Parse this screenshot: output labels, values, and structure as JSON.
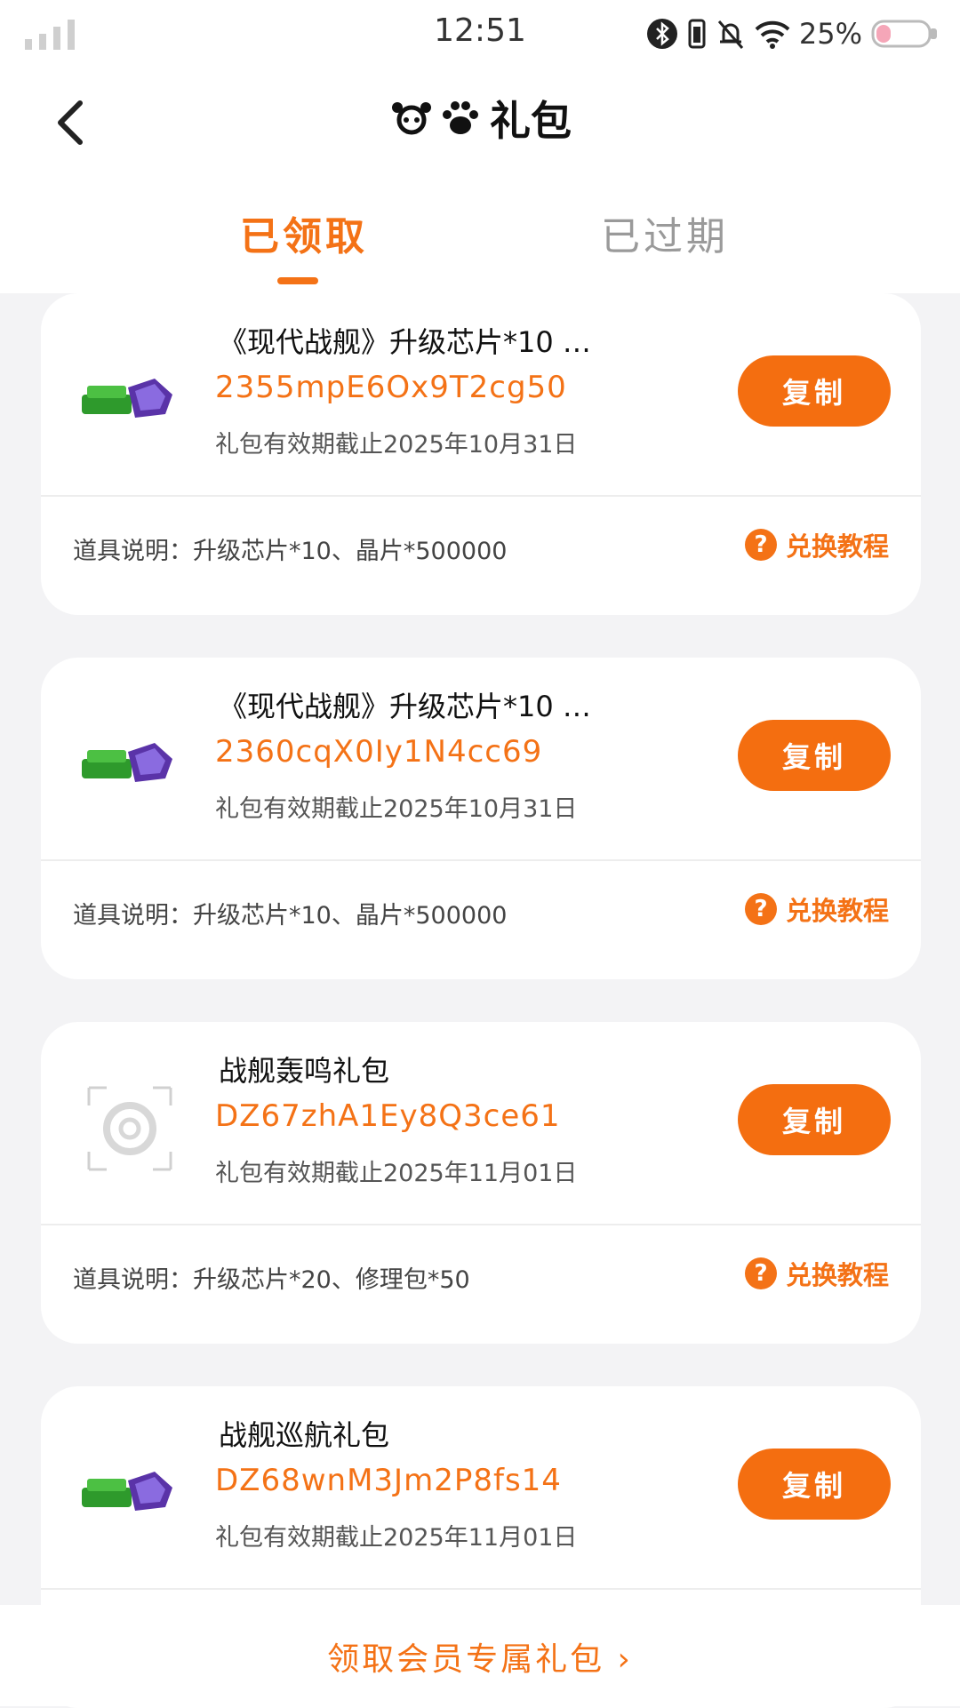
{
  "status_bar": {
    "time": "12:51",
    "battery_percent": "25%"
  },
  "header": {
    "title": "礼包"
  },
  "tabs": [
    {
      "label": "已领取",
      "active": true
    },
    {
      "label": "已过期",
      "active": false
    }
  ],
  "copy_label": "复制",
  "tutorial_label": "兑换教程",
  "gifts": [
    {
      "name": "《现代战舰》升级芯片*10 …",
      "code": "2355mpE6Ox9T2cg50",
      "expiry": "礼包有效期截止2025年10月31日",
      "description": "道具说明：升级芯片*10、晶片*500000",
      "thumb_icon": "gems-icon"
    },
    {
      "name": "《现代战舰》升级芯片*10 …",
      "code": "2360cqX0Iy1N4cc69",
      "expiry": "礼包有效期截止2025年10月31日",
      "description": "道具说明：升级芯片*10、晶片*500000",
      "thumb_icon": "gems-icon"
    },
    {
      "name": "战舰轰鸣礼包",
      "code": "DZ67zhA1Ey8Q3ce61",
      "expiry": "礼包有效期截止2025年11月01日",
      "description": "道具说明：升级芯片*20、修理包*50",
      "thumb_icon": "placeholder-icon"
    },
    {
      "name": "战舰巡航礼包",
      "code": "DZ68wnM3Jm2P8fs14",
      "expiry": "礼包有效期截止2025年11月01日",
      "description": "",
      "thumb_icon": "gems-icon"
    }
  ],
  "bottom": {
    "link_label": "领取会员专属礼包 ›"
  },
  "colors": {
    "accent": "#f47216",
    "background": "#f3f3f5"
  }
}
